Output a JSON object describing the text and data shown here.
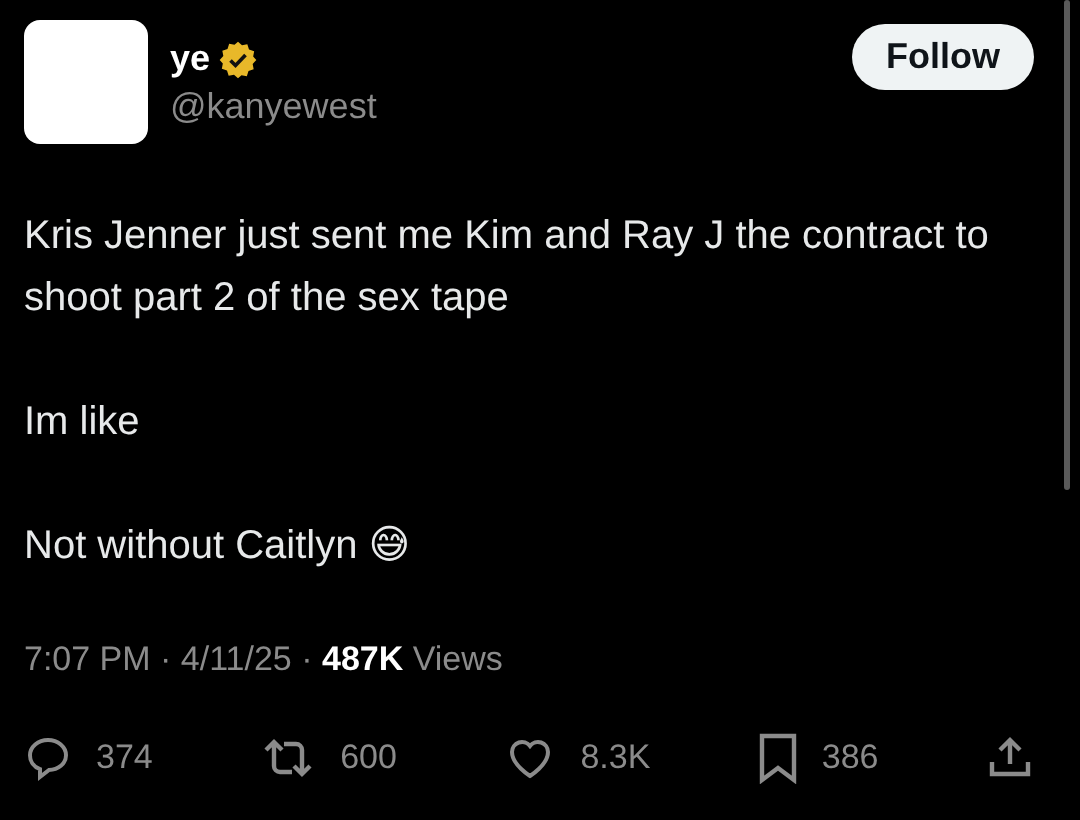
{
  "author": {
    "name": "ye",
    "verified": true,
    "handle": "@kanyewest"
  },
  "follow_button": "Follow",
  "paragraphs": [
    "Kris Jenner just sent me Kim and Ray J the contract to shoot part 2 of the sex tape",
    "Im like",
    "Not without Caitlyn 😅"
  ],
  "meta": "7:07 PM · 4/11/25 · **487K** Views",
  "actions": [
    {
      "kind": "reply",
      "count": "374"
    },
    {
      "kind": "repost",
      "count": "600"
    },
    {
      "kind": "like",
      "count": "8.3K"
    },
    {
      "kind": "bookmark",
      "count": "386"
    },
    {
      "kind": "share"
    }
  ]
}
